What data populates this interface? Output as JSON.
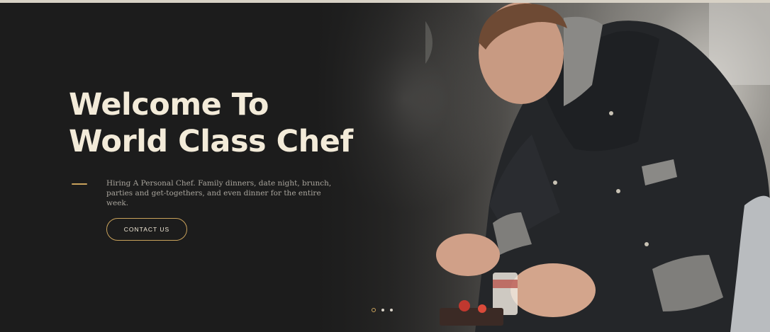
{
  "hero": {
    "title_line1": "Welcome To",
    "title_line2": "World Class Chef",
    "description": "Hiring A Personal Chef. Family dinners, date night, brunch, parties and get-togethers, and even dinner for the entire week.",
    "cta_label": "CONTACT US"
  },
  "slider": {
    "slide_count": 3,
    "active_index": 0
  },
  "colors": {
    "background": "#1c1c1c",
    "title": "#f3ebd9",
    "accent_gold": "#c9a25b",
    "description": "#a8a49c"
  },
  "icons": {
    "dash": "accent-dash-icon",
    "slider_dot": "slider-dot-icon"
  }
}
